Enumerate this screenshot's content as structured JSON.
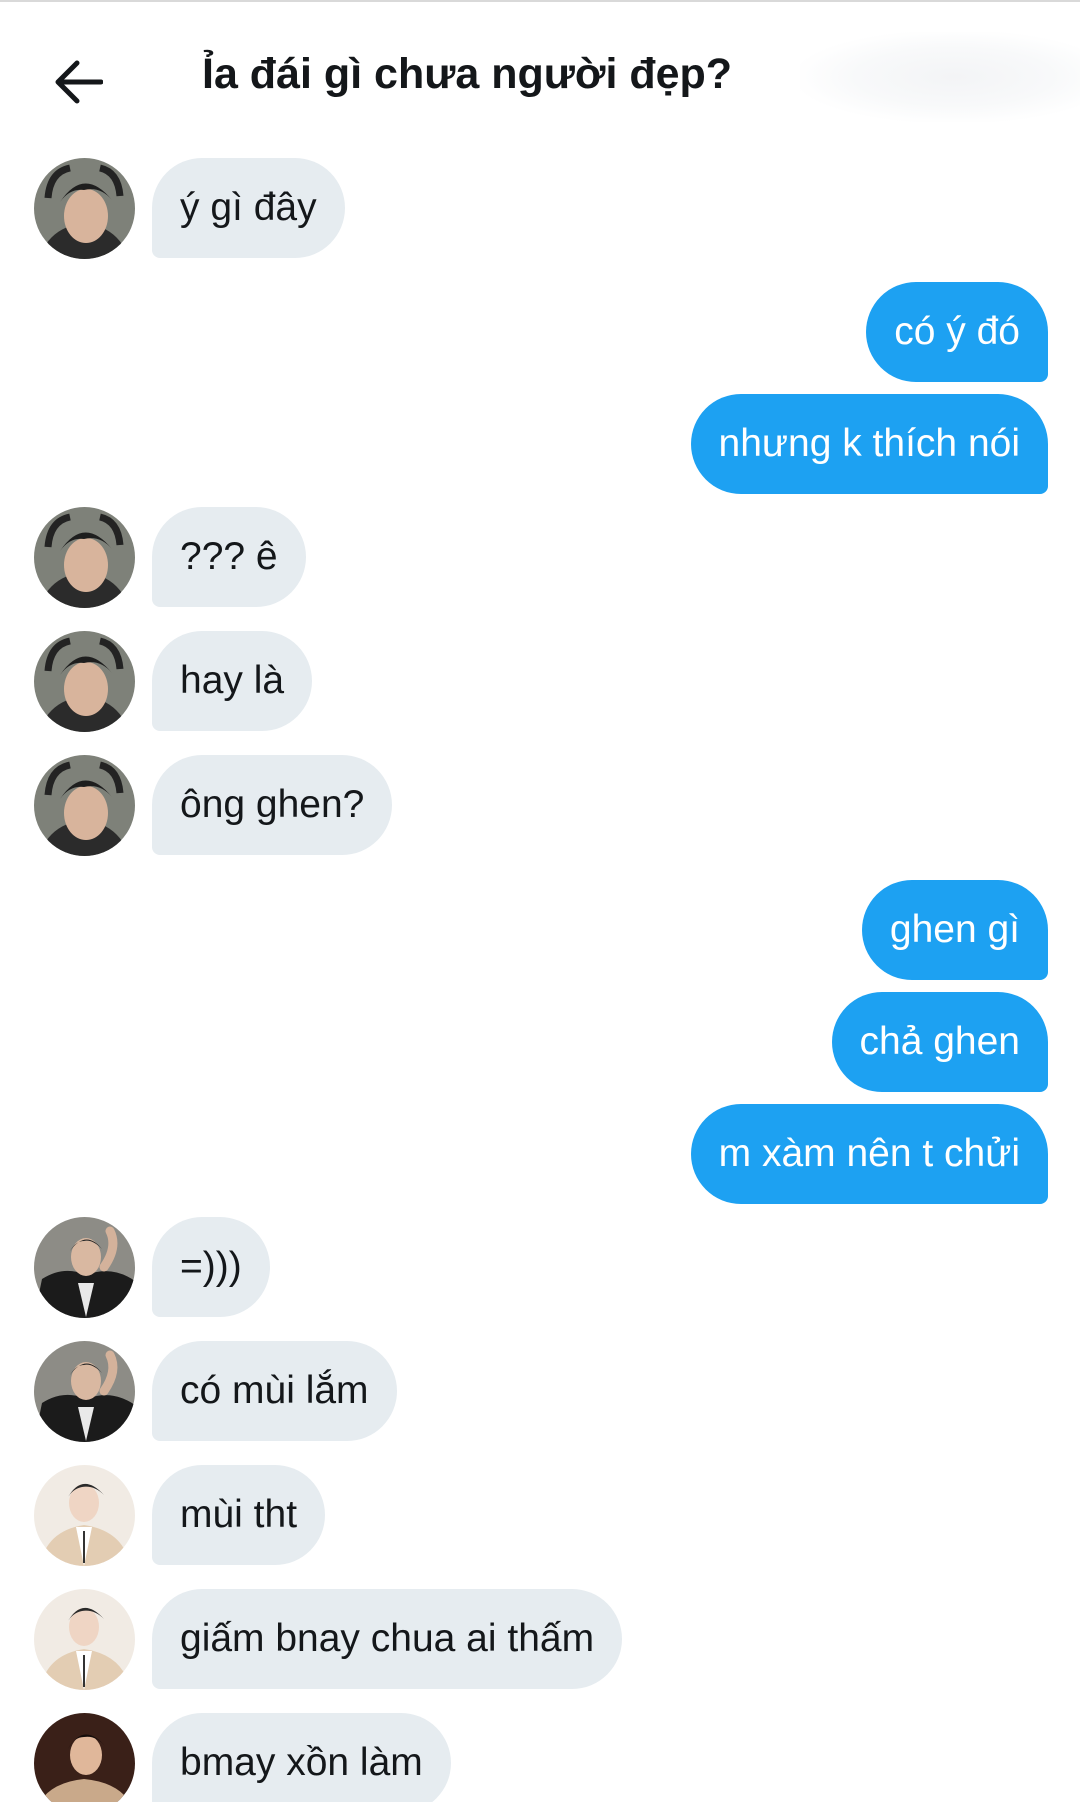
{
  "header": {
    "title": "Ỉa đái gì chưa người đẹp?",
    "back_icon": "arrow-left-icon"
  },
  "colors": {
    "incoming_bubble": "#e6ecf0",
    "outgoing_bubble": "#1da1f2",
    "text_dark": "#14171a",
    "text_light": "#ffffff"
  },
  "messages": [
    {
      "direction": "incoming",
      "text": "ý gì đây"
    },
    {
      "direction": "outgoing",
      "text": "có ý đó"
    },
    {
      "direction": "outgoing",
      "text": "nhưng k thích nói"
    },
    {
      "direction": "incoming",
      "text": "??? ê"
    },
    {
      "direction": "incoming",
      "text": "hay là"
    },
    {
      "direction": "incoming",
      "text": "ông ghen?"
    },
    {
      "direction": "outgoing",
      "text": "ghen gì"
    },
    {
      "direction": "outgoing",
      "text": "chả ghen"
    },
    {
      "direction": "outgoing",
      "text": "m xàm nên t chửi"
    },
    {
      "direction": "incoming",
      "text": "=)))"
    },
    {
      "direction": "incoming",
      "text": "có mùi lắm"
    },
    {
      "direction": "incoming",
      "text": "mùi tht"
    },
    {
      "direction": "incoming",
      "text": "giấm bnay chua ai thấm"
    },
    {
      "direction": "incoming",
      "text": "bmay xồn làm"
    }
  ]
}
